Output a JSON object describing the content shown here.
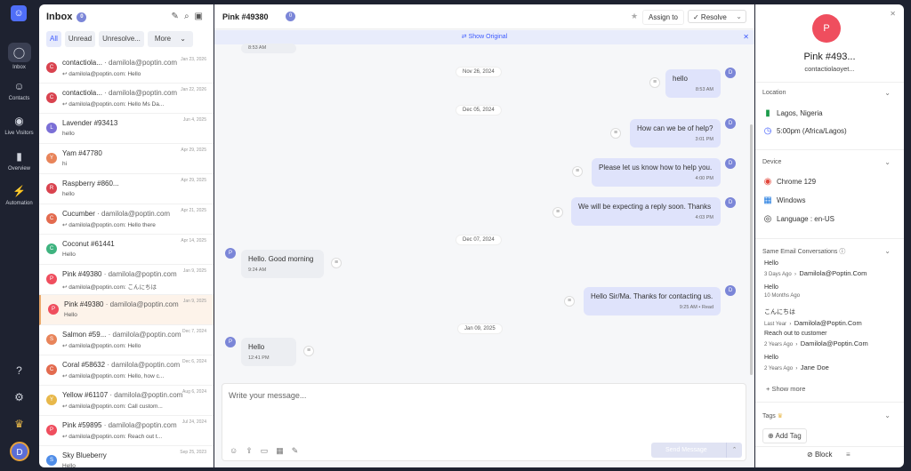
{
  "rail": {
    "logo": "☺",
    "nav": [
      {
        "label": "Inbox",
        "icon": "chat-bubble-icon"
      },
      {
        "label": "Contacts",
        "icon": "contacts-icon"
      },
      {
        "label": "Live Visitors",
        "icon": "broadcast-icon"
      },
      {
        "label": "Overview",
        "icon": "bar-chart-icon"
      },
      {
        "label": "Automation",
        "icon": "lightning-icon"
      }
    ],
    "avatar": "D"
  },
  "inbox": {
    "title": "Inbox",
    "count": "0",
    "filters": [
      "All",
      "Unread",
      "Unresolve...",
      "More"
    ],
    "items": [
      {
        "name": "contactiola...",
        "sub": "· damilola@poptin.com",
        "date": "Jan 23, 2026",
        "preview": "↩ damilola@poptin.com: Hello",
        "initial": "C",
        "color": "#d9434f"
      },
      {
        "name": "contactiola...",
        "sub": "· damilola@poptin.com",
        "date": "Jan 22, 2026",
        "preview": "↩ damilola@poptin.com: Hello Ms Da...",
        "initial": "C",
        "color": "#d9434f"
      },
      {
        "name": "Lavender #93413",
        "sub": "",
        "date": "Jun 4, 2025",
        "preview": "hello",
        "initial": "L",
        "color": "#7b6fd6"
      },
      {
        "name": "Yam #47780",
        "sub": "",
        "date": "Apr 29, 2025",
        "preview": "hi",
        "initial": "Y",
        "color": "#e8845a"
      },
      {
        "name": "Raspberry #860...",
        "sub": "",
        "date": "Apr 29, 2025",
        "preview": "hello",
        "initial": "R",
        "color": "#d9434f"
      },
      {
        "name": "Cucumber",
        "sub": "· damilola@poptin.com",
        "date": "Apr 21, 2025",
        "preview": "↩ damilola@poptin.com: Hello there",
        "initial": "C",
        "color": "#e36b4f"
      },
      {
        "name": "Coconut #61441",
        "sub": "",
        "date": "Apr 14, 2025",
        "preview": "Hello",
        "initial": "C",
        "color": "#3fb37f"
      },
      {
        "name": "Pink #49380",
        "sub": "· damilola@poptin.com",
        "date": "Jan 9, 2025",
        "preview": "↩ damilola@poptin.com: こんにちは",
        "initial": "P",
        "color": "#ef4e5e"
      },
      {
        "name": "Pink #49380",
        "sub": "· damilola@poptin.com",
        "date": "Jan 9, 2025",
        "preview": "Hello",
        "initial": "P",
        "color": "#ef4e5e",
        "selected": true
      },
      {
        "name": "Salmon #59...",
        "sub": "· damilola@poptin.com",
        "date": "Dec 7, 2024",
        "preview": "↩ damilola@poptin.com: Hello",
        "initial": "S",
        "color": "#e8845a"
      },
      {
        "name": "Coral #58632",
        "sub": "· damilola@poptin.com",
        "date": "Dec 6, 2024",
        "preview": "↩ damilola@poptin.com: Hello, how c...",
        "initial": "C",
        "color": "#e36b4f"
      },
      {
        "name": "Yellow #61107",
        "sub": "· damilola@poptin.com",
        "date": "Aug 6, 2024",
        "preview": "↩ damilola@poptin.com: Call custom...",
        "initial": "Y",
        "color": "#e8b84a"
      },
      {
        "name": "Pink #59895",
        "sub": "· damilola@poptin.com",
        "date": "Jul 24, 2024",
        "preview": "↩ damilola@poptin.com: Reach out t...",
        "initial": "P",
        "color": "#ef4e5e"
      },
      {
        "name": "Sky Blueberry",
        "sub": "",
        "date": "Sep 25, 2023",
        "preview": "Hello",
        "initial": "S",
        "color": "#4f8de8"
      }
    ]
  },
  "chat": {
    "title": "Pink #49380",
    "badge": "0",
    "assign": "Assign to",
    "resolve": "✓ Resolve",
    "show_original": "Show Original",
    "top_time": "8:53 AM",
    "dates": [
      "Nov 26, 2024",
      "Dec 05, 2024",
      "Dec 07, 2024",
      "Jan 09, 2025"
    ],
    "messages": [
      {
        "text": "hello",
        "time": "8:53 AM"
      },
      {
        "text": "How can we be of help?",
        "time": "3:01 PM"
      },
      {
        "text": "Please let us know how to help you.",
        "time": "4:00 PM"
      },
      {
        "text": "We will be expecting a reply soon. Thanks",
        "time": "4:03 PM"
      },
      {
        "text": "Hello. Good morning",
        "time": "9:24 AM"
      },
      {
        "text": "Hello Sir/Ma. Thanks for contacting us.",
        "time": "9:25 AM • Read"
      },
      {
        "text": "Hello",
        "time": "12:41 PM"
      }
    ],
    "composer_placeholder": "Write your message...",
    "send": "Send Message"
  },
  "contact": {
    "initial": "P",
    "name": "Pink #493...",
    "email": "contactiolaoyet...",
    "location_label": "Location",
    "city": "Lagos, Nigeria",
    "time": "5:00pm (Africa/Lagos)",
    "device_label": "Device",
    "browser": "Chrome 129",
    "os": "Windows",
    "language": "Language : en-US",
    "same_email_label": "Same Email Conversations",
    "conversations": [
      {
        "msg": "Hello",
        "when": "3 Days Ago",
        "to": "Damilola@Poptin.Com"
      },
      {
        "msg": "Hello",
        "when": "10 Months Ago",
        "to": ""
      },
      {
        "msg": "こんにちは",
        "when": "Last Year",
        "to": "Damilola@Poptin.Com"
      },
      {
        "msg": "Reach out to customer",
        "when": "2 Years Ago",
        "to": "Damilola@Poptin.Com"
      },
      {
        "msg": "Hello",
        "when": "2 Years Ago",
        "to": "Jane Doe"
      }
    ],
    "show_more": "+ Show more",
    "tags_label": "Tags",
    "add_tag": "Add Tag",
    "block": "Block"
  },
  "colors": {
    "accent": "#3d5afe",
    "avatar": "#7b86d8",
    "contact_avatar": "#ef4e5e"
  }
}
